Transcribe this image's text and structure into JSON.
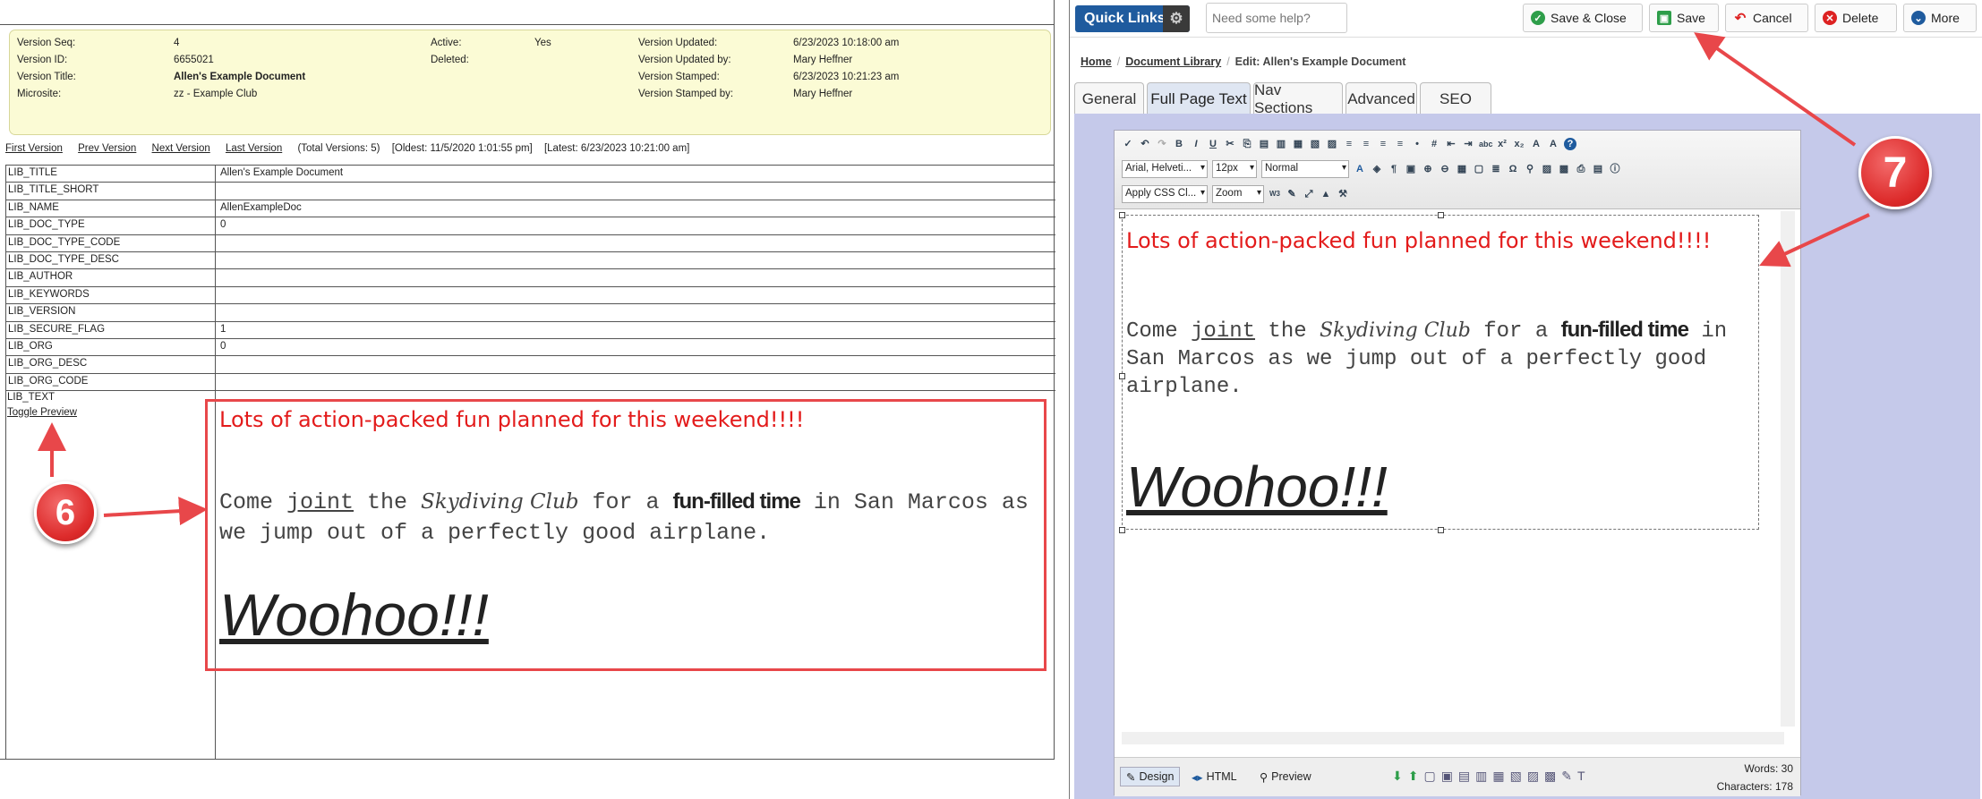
{
  "meta": {
    "version_seq_label": "Version Seq:",
    "version_seq": "4",
    "version_id_label": "Version ID:",
    "version_id": "6655021",
    "version_title_label": "Version Title:",
    "version_title": "Allen's Example Document",
    "microsite_label": "Microsite:",
    "microsite": "zz - Example Club",
    "active_label": "Active:",
    "active": "Yes",
    "deleted_label": "Deleted:",
    "updated_label": "Version Updated:",
    "updated": "6/23/2023 10:18:00 am",
    "updated_by_label": "Version Updated by:",
    "updated_by": "Mary Heffner",
    "stamped_label": "Version Stamped:",
    "stamped": "6/23/2023 10:21:23 am",
    "stamped_by_label": "Version Stamped by:",
    "stamped_by": "Mary Heffner"
  },
  "version_nav": {
    "first": "First Version",
    "prev": "Prev Version",
    "next": "Next Version",
    "last": "Last Version",
    "total": "(Total Versions: 5)",
    "oldest": "[Oldest: 11/5/2020 1:01:55 pm]",
    "latest": "[Latest: 6/23/2023 10:21:00 am]"
  },
  "fields": [
    {
      "name": "LIB_TITLE",
      "value": "Allen's Example Document"
    },
    {
      "name": "LIB_TITLE_SHORT",
      "value": ""
    },
    {
      "name": "LIB_NAME",
      "value": "AllenExampleDoc"
    },
    {
      "name": "LIB_DOC_TYPE",
      "value": "0"
    },
    {
      "name": "LIB_DOC_TYPE_CODE",
      "value": ""
    },
    {
      "name": "LIB_DOC_TYPE_DESC",
      "value": ""
    },
    {
      "name": "LIB_AUTHOR",
      "value": ""
    },
    {
      "name": "LIB_KEYWORDS",
      "value": ""
    },
    {
      "name": "LIB_VERSION",
      "value": ""
    },
    {
      "name": "LIB_SECURE_FLAG",
      "value": "1"
    },
    {
      "name": "LIB_ORG",
      "value": "0"
    },
    {
      "name": "LIB_ORG_DESC",
      "value": ""
    },
    {
      "name": "LIB_ORG_CODE",
      "value": ""
    }
  ],
  "lib_text_label": "LIB_TEXT",
  "toggle_preview": "Toggle Preview",
  "doc": {
    "heading": "Lots of action-packed fun planned for this weekend!!!!",
    "body_1": "Come ",
    "body_2": "joint",
    "body_3": " the ",
    "body_club": "Skydiving Club",
    "body_4": " for a ",
    "body_bold": "fun-filled time",
    "body_5": " in San Marcos as we jump out of a perfectly good airplane.",
    "woohoo": "Woohoo!!!"
  },
  "callouts": {
    "left": "6",
    "right": "7"
  },
  "topbar": {
    "quick_links": "Quick Links",
    "help_placeholder": "Need some help?",
    "save_close": "Save & Close",
    "save": "Save",
    "cancel": "Cancel",
    "delete": "Delete",
    "more": "More"
  },
  "breadcrumb": {
    "home": "Home",
    "library": "Document Library",
    "current": "Edit: Allen's Example Document"
  },
  "tabs": [
    "General",
    "Full Page Text",
    "Nav Sections",
    "Advanced",
    "SEO"
  ],
  "editor": {
    "font": "Arial, Helveti...",
    "size": "12px",
    "format": "Normal",
    "css": "Apply CSS Cl...",
    "zoom": "Zoom",
    "design": "Design",
    "html": "HTML",
    "preview": "Preview",
    "words": "Words: 30",
    "chars": "Characters: 178"
  },
  "colors": {
    "accent_red": "#e31b1b",
    "quick_links_blue": "#1f5b9e",
    "note_bg": "#fbfbd5"
  }
}
